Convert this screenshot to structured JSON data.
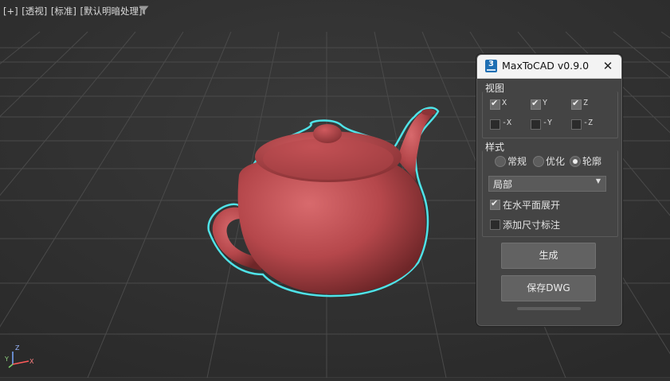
{
  "viewport": {
    "labels": [
      "[+]",
      "[透视]",
      "[标准]",
      "[默认明暗处理]"
    ],
    "filter_icon": "funnel-icon",
    "axis": {
      "x": "X",
      "y": "Y",
      "z": "Z"
    },
    "object": "teapot",
    "object_color": "#b5474b",
    "selection_outline_color": "#4fe3e8",
    "grid_color": "#4a4a4a"
  },
  "dialog": {
    "title": "MaxToCAD v0.9.0",
    "app_icon_text": "3",
    "close_icon": "close-icon",
    "view_section": {
      "label": "视图",
      "checkboxes": [
        {
          "label": "X",
          "checked": true
        },
        {
          "label": "Y",
          "checked": true
        },
        {
          "label": "Z",
          "checked": true
        },
        {
          "label": "-X",
          "checked": false
        },
        {
          "label": "-Y",
          "checked": false
        },
        {
          "label": "-Z",
          "checked": false
        }
      ]
    },
    "style_section": {
      "label": "样式",
      "radios": [
        {
          "label": "常规",
          "selected": false
        },
        {
          "label": "优化",
          "selected": false
        },
        {
          "label": "轮廓",
          "selected": true
        }
      ],
      "dropdown": {
        "value": "局部"
      },
      "options": [
        {
          "label": "在水平面展开",
          "checked": true
        },
        {
          "label": "添加尺寸标注",
          "checked": false
        }
      ]
    },
    "buttons": {
      "generate": "生成",
      "save": "保存DWG"
    }
  }
}
